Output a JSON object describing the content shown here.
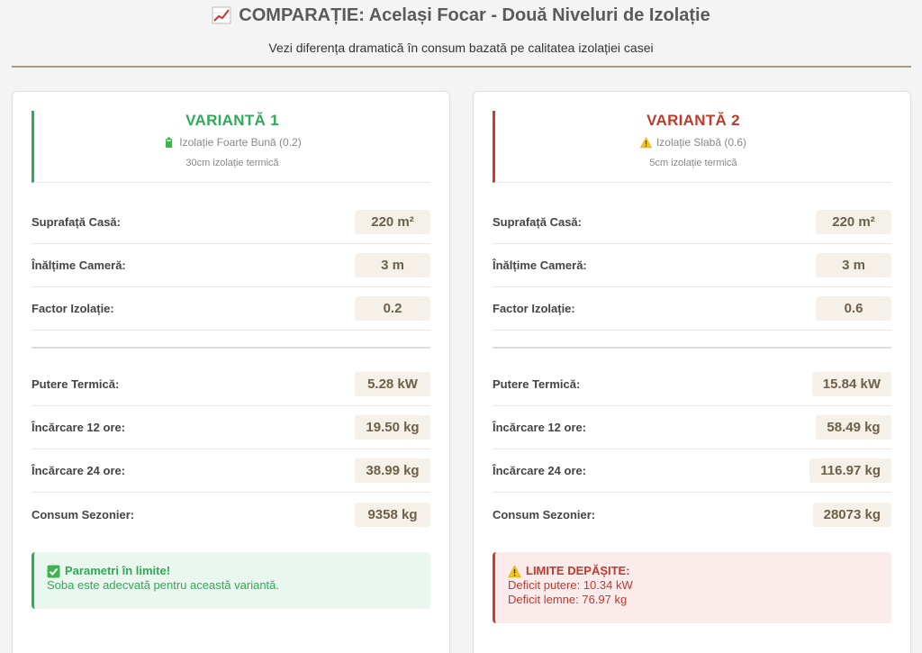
{
  "header": {
    "title": "COMPARAȚIE: Același Focar - Două Niveluri de Izolație",
    "title_icon": "chart-increasing-icon",
    "subtitle": "Vezi diferența dramatică în consum bazată pe calitatea izolației casei"
  },
  "variants": [
    {
      "title": "VARIANTĂ 1",
      "accent": "#2eaa58",
      "quality_icon": "battery-icon",
      "quality": "Izolație Foarte Bună (0.2)",
      "note": "30cm izolație termică",
      "inputs": [
        {
          "label": "Suprafață Casă:",
          "value": "220 m²"
        },
        {
          "label": "Înălțime Cameră:",
          "value": "3 m"
        },
        {
          "label": "Factor Izolație:",
          "value": "0.2"
        }
      ],
      "results": [
        {
          "label": "Putere Termică:",
          "value": "5.28 kW"
        },
        {
          "label": "Încărcare 12 ore:",
          "value": "19.50 kg"
        },
        {
          "label": "Încărcare 24 ore:",
          "value": "38.99 kg"
        },
        {
          "label": "Consum Sezonier:",
          "value": "9358 kg"
        }
      ],
      "alert": {
        "icon": "check-mark-icon",
        "title": "Parametri în limite!",
        "lines": [
          "Soba este adecvată pentru această variantă."
        ]
      }
    },
    {
      "title": "VARIANTĂ 2",
      "accent": "#c0392b",
      "quality_icon": "warning-icon",
      "quality": "Izolație Slabă (0.6)",
      "note": "5cm izolație termică",
      "inputs": [
        {
          "label": "Suprafață Casă:",
          "value": "220 m²"
        },
        {
          "label": "Înălțime Cameră:",
          "value": "3 m"
        },
        {
          "label": "Factor Izolație:",
          "value": "0.6"
        }
      ],
      "results": [
        {
          "label": "Putere Termică:",
          "value": "15.84 kW"
        },
        {
          "label": "Încărcare 12 ore:",
          "value": "58.49 kg"
        },
        {
          "label": "Încărcare 24 ore:",
          "value": "116.97 kg"
        },
        {
          "label": "Consum Sezonier:",
          "value": "28073 kg"
        }
      ],
      "alert": {
        "icon": "warning-icon",
        "title": "LIMITE DEPĂȘITE:",
        "lines": [
          "Deficit putere: 10.34 kW",
          "Deficit lemne: 76.97 kg"
        ]
      }
    }
  ]
}
